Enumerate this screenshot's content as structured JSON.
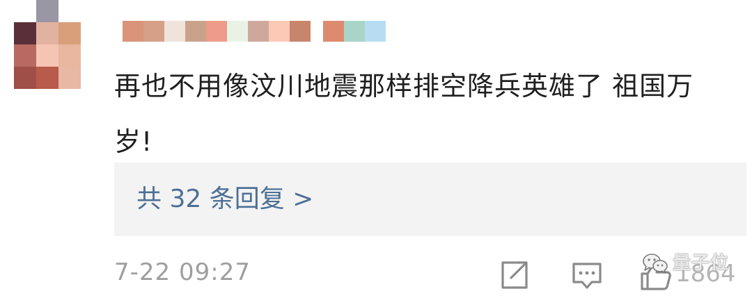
{
  "comment": {
    "avatar_colors": [
      "#ffffff",
      "#9a96a4",
      "#ffffff",
      "#5a2f3a",
      "#e2b2a0",
      "#d8a07a",
      "#b86a62",
      "#f6c4b2",
      "#e9b7a0",
      "#a04e48",
      "#b85a4c",
      "#e8b8a4"
    ],
    "username_colors": [
      "#d9947a",
      "#d6a088",
      "#efe3dc",
      "#c9a28c",
      "#ee9b8a",
      "#e8f3e6",
      "#cfa89c",
      "#fbc9b6",
      "#c7866c",
      "#dd8a6e",
      "#a9d4c8",
      "#b8dcf2"
    ],
    "text": "再也不用像汶川地震那样排空降兵英雄了 祖国万岁!",
    "replies_label": "共 32 条回复 >",
    "timestamp": "7-22 09:27",
    "like_count": "1864",
    "icons": [
      "share-icon",
      "reply-icon",
      "like-icon"
    ]
  },
  "watermark": {
    "text": "量子位",
    "icon": "wechat-logo"
  },
  "colors": {
    "link": "#4d6f96",
    "meta": "#9e9e9e",
    "reply_box_bg": "#f3f3f3"
  }
}
